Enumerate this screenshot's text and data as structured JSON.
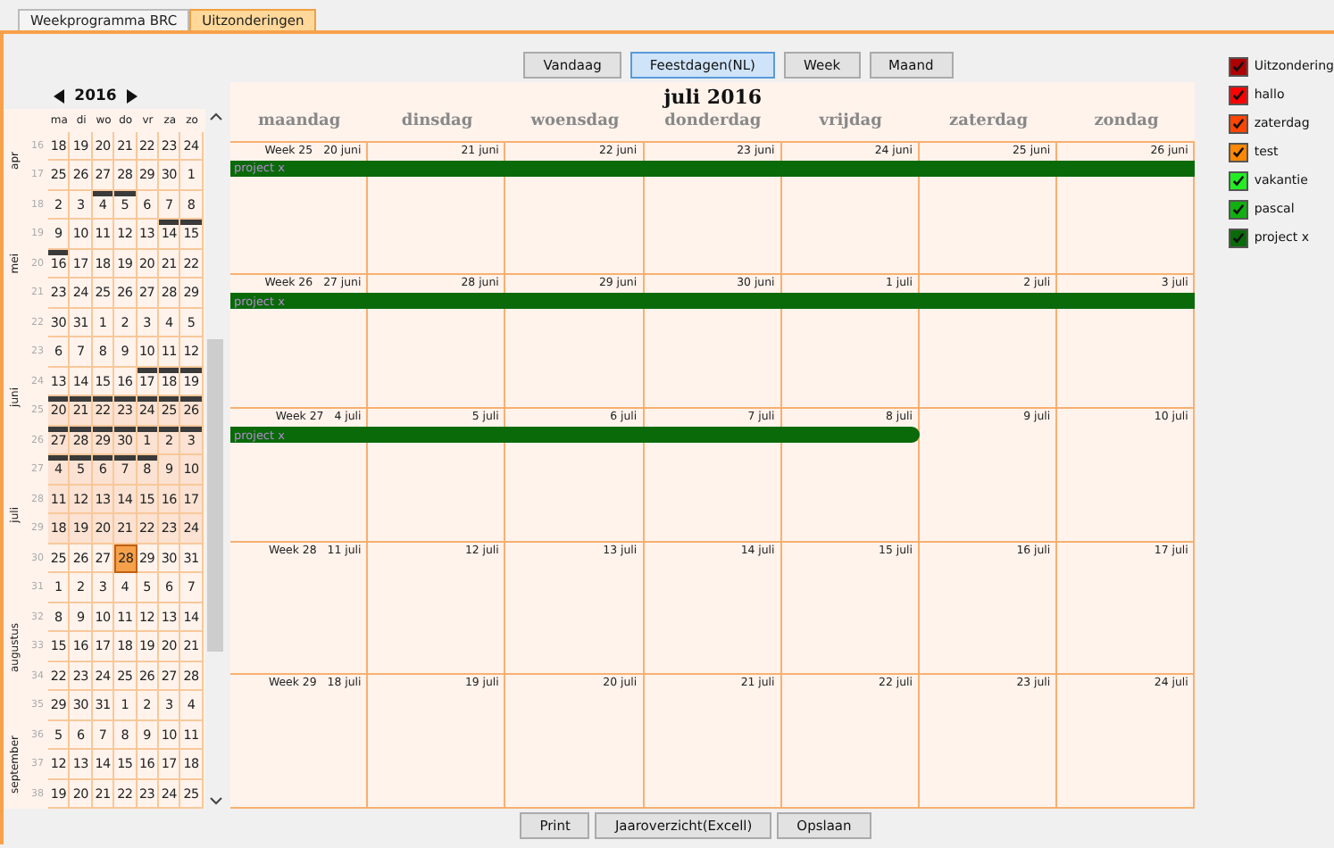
{
  "tabs": [
    {
      "label": "Weekprogramma BRC",
      "selected": false
    },
    {
      "label": "Uitzonderingen",
      "selected": true
    }
  ],
  "toolbar": [
    {
      "label": "Vandaag",
      "selected": false
    },
    {
      "label": "Feestdagen(NL)",
      "selected": true
    },
    {
      "label": "Week",
      "selected": false
    },
    {
      "label": "Maand",
      "selected": false
    }
  ],
  "mini_calendar": {
    "year": "2016",
    "weekdays": [
      "ma",
      "di",
      "wo",
      "do",
      "vr",
      "za",
      "zo"
    ],
    "months": [
      {
        "name": "apr",
        "rows": [
          {
            "week": "16",
            "in_view": false,
            "days": [
              {
                "d": "18",
                "marked": false,
                "selected": false
              },
              {
                "d": "19",
                "marked": false,
                "selected": false
              },
              {
                "d": "20",
                "marked": false,
                "selected": false
              },
              {
                "d": "21",
                "marked": false,
                "selected": false
              },
              {
                "d": "22",
                "marked": false,
                "selected": false
              },
              {
                "d": "23",
                "marked": false,
                "selected": false
              },
              {
                "d": "24",
                "marked": false,
                "selected": false
              }
            ]
          },
          {
            "week": "17",
            "in_view": false,
            "days": [
              {
                "d": "25",
                "marked": false,
                "selected": false
              },
              {
                "d": "26",
                "marked": false,
                "selected": false
              },
              {
                "d": "27",
                "marked": false,
                "selected": false
              },
              {
                "d": "28",
                "marked": false,
                "selected": false
              },
              {
                "d": "29",
                "marked": false,
                "selected": false
              },
              {
                "d": "30",
                "marked": false,
                "selected": false
              },
              {
                "d": "1",
                "marked": false,
                "selected": false
              }
            ]
          }
        ]
      },
      {
        "name": "mei",
        "rows": [
          {
            "week": "18",
            "in_view": false,
            "days": [
              {
                "d": "2",
                "marked": false,
                "selected": false
              },
              {
                "d": "3",
                "marked": false,
                "selected": false
              },
              {
                "d": "4",
                "marked": true,
                "selected": false
              },
              {
                "d": "5",
                "marked": true,
                "selected": false
              },
              {
                "d": "6",
                "marked": false,
                "selected": false
              },
              {
                "d": "7",
                "marked": false,
                "selected": false
              },
              {
                "d": "8",
                "marked": false,
                "selected": false
              }
            ]
          },
          {
            "week": "19",
            "in_view": false,
            "days": [
              {
                "d": "9",
                "marked": false,
                "selected": false
              },
              {
                "d": "10",
                "marked": false,
                "selected": false
              },
              {
                "d": "11",
                "marked": false,
                "selected": false
              },
              {
                "d": "12",
                "marked": false,
                "selected": false
              },
              {
                "d": "13",
                "marked": false,
                "selected": false
              },
              {
                "d": "14",
                "marked": true,
                "selected": false
              },
              {
                "d": "15",
                "marked": true,
                "selected": false
              }
            ]
          },
          {
            "week": "20",
            "in_view": false,
            "days": [
              {
                "d": "16",
                "marked": true,
                "selected": false
              },
              {
                "d": "17",
                "marked": false,
                "selected": false
              },
              {
                "d": "18",
                "marked": false,
                "selected": false
              },
              {
                "d": "19",
                "marked": false,
                "selected": false
              },
              {
                "d": "20",
                "marked": false,
                "selected": false
              },
              {
                "d": "21",
                "marked": false,
                "selected": false
              },
              {
                "d": "22",
                "marked": false,
                "selected": false
              }
            ]
          },
          {
            "week": "21",
            "in_view": false,
            "days": [
              {
                "d": "23",
                "marked": false,
                "selected": false
              },
              {
                "d": "24",
                "marked": false,
                "selected": false
              },
              {
                "d": "25",
                "marked": false,
                "selected": false
              },
              {
                "d": "26",
                "marked": false,
                "selected": false
              },
              {
                "d": "27",
                "marked": false,
                "selected": false
              },
              {
                "d": "28",
                "marked": false,
                "selected": false
              },
              {
                "d": "29",
                "marked": false,
                "selected": false
              }
            ]
          },
          {
            "week": "22",
            "in_view": false,
            "days": [
              {
                "d": "30",
                "marked": false,
                "selected": false
              },
              {
                "d": "31",
                "marked": false,
                "selected": false
              },
              {
                "d": "1",
                "marked": false,
                "selected": false
              },
              {
                "d": "2",
                "marked": false,
                "selected": false
              },
              {
                "d": "3",
                "marked": false,
                "selected": false
              },
              {
                "d": "4",
                "marked": false,
                "selected": false
              },
              {
                "d": "5",
                "marked": false,
                "selected": false
              }
            ]
          }
        ]
      },
      {
        "name": "juni",
        "rows": [
          {
            "week": "23",
            "in_view": false,
            "days": [
              {
                "d": "6",
                "marked": false,
                "selected": false
              },
              {
                "d": "7",
                "marked": false,
                "selected": false
              },
              {
                "d": "8",
                "marked": false,
                "selected": false
              },
              {
                "d": "9",
                "marked": false,
                "selected": false
              },
              {
                "d": "10",
                "marked": false,
                "selected": false
              },
              {
                "d": "11",
                "marked": false,
                "selected": false
              },
              {
                "d": "12",
                "marked": false,
                "selected": false
              }
            ]
          },
          {
            "week": "24",
            "in_view": false,
            "days": [
              {
                "d": "13",
                "marked": false,
                "selected": false
              },
              {
                "d": "14",
                "marked": false,
                "selected": false
              },
              {
                "d": "15",
                "marked": false,
                "selected": false
              },
              {
                "d": "16",
                "marked": false,
                "selected": false
              },
              {
                "d": "17",
                "marked": true,
                "selected": false
              },
              {
                "d": "18",
                "marked": true,
                "selected": false
              },
              {
                "d": "19",
                "marked": true,
                "selected": false
              }
            ]
          },
          {
            "week": "25",
            "in_view": true,
            "days": [
              {
                "d": "20",
                "marked": true,
                "selected": false
              },
              {
                "d": "21",
                "marked": true,
                "selected": false
              },
              {
                "d": "22",
                "marked": true,
                "selected": false
              },
              {
                "d": "23",
                "marked": true,
                "selected": false
              },
              {
                "d": "24",
                "marked": true,
                "selected": false
              },
              {
                "d": "25",
                "marked": true,
                "selected": false
              },
              {
                "d": "26",
                "marked": true,
                "selected": false
              }
            ]
          },
          {
            "week": "26",
            "in_view": true,
            "days": [
              {
                "d": "27",
                "marked": true,
                "selected": false
              },
              {
                "d": "28",
                "marked": true,
                "selected": false
              },
              {
                "d": "29",
                "marked": true,
                "selected": false
              },
              {
                "d": "30",
                "marked": true,
                "selected": false
              },
              {
                "d": "1",
                "marked": true,
                "selected": false
              },
              {
                "d": "2",
                "marked": true,
                "selected": false
              },
              {
                "d": "3",
                "marked": true,
                "selected": false
              }
            ]
          }
        ]
      },
      {
        "name": "juli",
        "rows": [
          {
            "week": "27",
            "in_view": true,
            "days": [
              {
                "d": "4",
                "marked": true,
                "selected": false
              },
              {
                "d": "5",
                "marked": true,
                "selected": false
              },
              {
                "d": "6",
                "marked": true,
                "selected": false
              },
              {
                "d": "7",
                "marked": true,
                "selected": false
              },
              {
                "d": "8",
                "marked": true,
                "selected": false
              },
              {
                "d": "9",
                "marked": false,
                "selected": false
              },
              {
                "d": "10",
                "marked": false,
                "selected": false
              }
            ]
          },
          {
            "week": "28",
            "in_view": true,
            "days": [
              {
                "d": "11",
                "marked": false,
                "selected": false
              },
              {
                "d": "12",
                "marked": false,
                "selected": false
              },
              {
                "d": "13",
                "marked": false,
                "selected": false
              },
              {
                "d": "14",
                "marked": false,
                "selected": false
              },
              {
                "d": "15",
                "marked": false,
                "selected": false
              },
              {
                "d": "16",
                "marked": false,
                "selected": false
              },
              {
                "d": "17",
                "marked": false,
                "selected": false
              }
            ]
          },
          {
            "week": "29",
            "in_view": true,
            "days": [
              {
                "d": "18",
                "marked": false,
                "selected": false
              },
              {
                "d": "19",
                "marked": false,
                "selected": false
              },
              {
                "d": "20",
                "marked": false,
                "selected": false
              },
              {
                "d": "21",
                "marked": false,
                "selected": false
              },
              {
                "d": "22",
                "marked": false,
                "selected": false
              },
              {
                "d": "23",
                "marked": false,
                "selected": false
              },
              {
                "d": "24",
                "marked": false,
                "selected": false
              }
            ]
          },
          {
            "week": "30",
            "in_view": false,
            "days": [
              {
                "d": "25",
                "marked": false,
                "selected": false
              },
              {
                "d": "26",
                "marked": false,
                "selected": false
              },
              {
                "d": "27",
                "marked": false,
                "selected": false
              },
              {
                "d": "28",
                "marked": false,
                "selected": true
              },
              {
                "d": "29",
                "marked": false,
                "selected": false
              },
              {
                "d": "30",
                "marked": false,
                "selected": false
              },
              {
                "d": "31",
                "marked": false,
                "selected": false
              }
            ]
          }
        ]
      },
      {
        "name": "augustus",
        "rows": [
          {
            "week": "31",
            "in_view": false,
            "days": [
              {
                "d": "1",
                "marked": false,
                "selected": false
              },
              {
                "d": "2",
                "marked": false,
                "selected": false
              },
              {
                "d": "3",
                "marked": false,
                "selected": false
              },
              {
                "d": "4",
                "marked": false,
                "selected": false
              },
              {
                "d": "5",
                "marked": false,
                "selected": false
              },
              {
                "d": "6",
                "marked": false,
                "selected": false
              },
              {
                "d": "7",
                "marked": false,
                "selected": false
              }
            ]
          },
          {
            "week": "32",
            "in_view": false,
            "days": [
              {
                "d": "8",
                "marked": false,
                "selected": false
              },
              {
                "d": "9",
                "marked": false,
                "selected": false
              },
              {
                "d": "10",
                "marked": false,
                "selected": false
              },
              {
                "d": "11",
                "marked": false,
                "selected": false
              },
              {
                "d": "12",
                "marked": false,
                "selected": false
              },
              {
                "d": "13",
                "marked": false,
                "selected": false
              },
              {
                "d": "14",
                "marked": false,
                "selected": false
              }
            ]
          },
          {
            "week": "33",
            "in_view": false,
            "days": [
              {
                "d": "15",
                "marked": false,
                "selected": false
              },
              {
                "d": "16",
                "marked": false,
                "selected": false
              },
              {
                "d": "17",
                "marked": false,
                "selected": false
              },
              {
                "d": "18",
                "marked": false,
                "selected": false
              },
              {
                "d": "19",
                "marked": false,
                "selected": false
              },
              {
                "d": "20",
                "marked": false,
                "selected": false
              },
              {
                "d": "21",
                "marked": false,
                "selected": false
              }
            ]
          },
          {
            "week": "34",
            "in_view": false,
            "days": [
              {
                "d": "22",
                "marked": false,
                "selected": false
              },
              {
                "d": "23",
                "marked": false,
                "selected": false
              },
              {
                "d": "24",
                "marked": false,
                "selected": false
              },
              {
                "d": "25",
                "marked": false,
                "selected": false
              },
              {
                "d": "26",
                "marked": false,
                "selected": false
              },
              {
                "d": "27",
                "marked": false,
                "selected": false
              },
              {
                "d": "28",
                "marked": false,
                "selected": false
              }
            ]
          },
          {
            "week": "35",
            "in_view": false,
            "days": [
              {
                "d": "29",
                "marked": false,
                "selected": false
              },
              {
                "d": "30",
                "marked": false,
                "selected": false
              },
              {
                "d": "31",
                "marked": false,
                "selected": false
              },
              {
                "d": "1",
                "marked": false,
                "selected": false
              },
              {
                "d": "2",
                "marked": false,
                "selected": false
              },
              {
                "d": "3",
                "marked": false,
                "selected": false
              },
              {
                "d": "4",
                "marked": false,
                "selected": false
              }
            ]
          }
        ]
      },
      {
        "name": "september",
        "rows": [
          {
            "week": "36",
            "in_view": false,
            "days": [
              {
                "d": "5",
                "marked": false,
                "selected": false
              },
              {
                "d": "6",
                "marked": false,
                "selected": false
              },
              {
                "d": "7",
                "marked": false,
                "selected": false
              },
              {
                "d": "8",
                "marked": false,
                "selected": false
              },
              {
                "d": "9",
                "marked": false,
                "selected": false
              },
              {
                "d": "10",
                "marked": false,
                "selected": false
              },
              {
                "d": "11",
                "marked": false,
                "selected": false
              }
            ]
          },
          {
            "week": "37",
            "in_view": false,
            "days": [
              {
                "d": "12",
                "marked": false,
                "selected": false
              },
              {
                "d": "13",
                "marked": false,
                "selected": false
              },
              {
                "d": "14",
                "marked": false,
                "selected": false
              },
              {
                "d": "15",
                "marked": false,
                "selected": false
              },
              {
                "d": "16",
                "marked": false,
                "selected": false
              },
              {
                "d": "17",
                "marked": false,
                "selected": false
              },
              {
                "d": "18",
                "marked": false,
                "selected": false
              }
            ]
          },
          {
            "week": "38",
            "in_view": false,
            "days": [
              {
                "d": "19",
                "marked": false,
                "selected": false
              },
              {
                "d": "20",
                "marked": false,
                "selected": false
              },
              {
                "d": "21",
                "marked": false,
                "selected": false
              },
              {
                "d": "22",
                "marked": false,
                "selected": false
              },
              {
                "d": "23",
                "marked": false,
                "selected": false
              },
              {
                "d": "24",
                "marked": false,
                "selected": false
              },
              {
                "d": "25",
                "marked": false,
                "selected": false
              }
            ]
          }
        ]
      }
    ]
  },
  "calendar": {
    "title": "juli 2016",
    "weekdays": [
      "maandag",
      "dinsdag",
      "woensdag",
      "donderdag",
      "vrijdag",
      "zaterdag",
      "zondag"
    ],
    "weeks": [
      {
        "week": "Week 25",
        "event_label": "project x",
        "days": [
          {
            "date": "20 juni",
            "event": true
          },
          {
            "date": "21 juni",
            "event": true
          },
          {
            "date": "22 juni",
            "event": true
          },
          {
            "date": "23 juni",
            "event": true
          },
          {
            "date": "24 juni",
            "event": true
          },
          {
            "date": "25 juni",
            "event": true
          },
          {
            "date": "26 juni",
            "event": true
          }
        ]
      },
      {
        "week": "Week 26",
        "event_label": "project x",
        "days": [
          {
            "date": "27 juni",
            "event": true
          },
          {
            "date": "28 juni",
            "event": true
          },
          {
            "date": "29 juni",
            "event": true
          },
          {
            "date": "30 juni",
            "event": true
          },
          {
            "date": "1 juli",
            "event": true
          },
          {
            "date": "2 juli",
            "event": true
          },
          {
            "date": "3 juli",
            "event": true
          }
        ]
      },
      {
        "week": "Week 27",
        "event_label": "project x",
        "days": [
          {
            "date": "4 juli",
            "event": true
          },
          {
            "date": "5 juli",
            "event": true
          },
          {
            "date": "6 juli",
            "event": true
          },
          {
            "date": "7 juli",
            "event": true
          },
          {
            "date": "8 juli",
            "event": true
          },
          {
            "date": "9 juli",
            "event": false
          },
          {
            "date": "10 juli",
            "event": false
          }
        ]
      },
      {
        "week": "Week 28",
        "days": [
          {
            "date": "11 juli",
            "event": false
          },
          {
            "date": "12 juli",
            "event": false
          },
          {
            "date": "13 juli",
            "event": false
          },
          {
            "date": "14 juli",
            "event": false
          },
          {
            "date": "15 juli",
            "event": false
          },
          {
            "date": "16 juli",
            "event": false
          },
          {
            "date": "17 juli",
            "event": false
          }
        ]
      },
      {
        "week": "Week 29",
        "days": [
          {
            "date": "18 juli",
            "event": false
          },
          {
            "date": "19 juli",
            "event": false
          },
          {
            "date": "20 juli",
            "event": false
          },
          {
            "date": "21 juli",
            "event": false
          },
          {
            "date": "22 juli",
            "event": false
          },
          {
            "date": "23 juli",
            "event": false
          },
          {
            "date": "24 juli",
            "event": false
          }
        ]
      }
    ]
  },
  "legend": [
    {
      "label": "Uitzondering",
      "color": "#b00000",
      "checked": true
    },
    {
      "label": "hallo",
      "color": "#ff0000",
      "checked": true
    },
    {
      "label": "zaterdag",
      "color": "#ff4400",
      "checked": true
    },
    {
      "label": "test",
      "color": "#ff8800",
      "checked": true
    },
    {
      "label": "vakantie",
      "color": "#22ee22",
      "checked": true
    },
    {
      "label": "pascal",
      "color": "#10b010",
      "checked": true
    },
    {
      "label": "project x",
      "color": "#0a6a0a",
      "checked": true
    }
  ],
  "footer": [
    "Print",
    "Jaaroverzicht(Excell)",
    "Opslaan"
  ]
}
